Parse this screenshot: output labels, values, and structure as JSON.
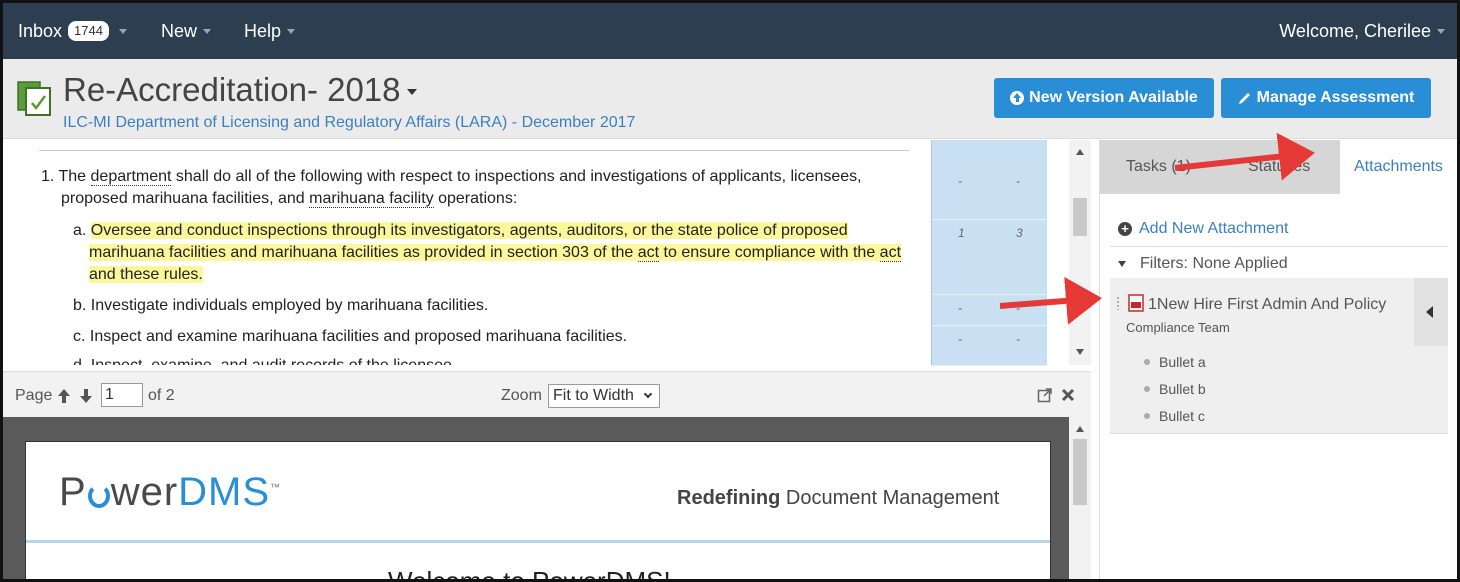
{
  "nav": {
    "inbox_label": "Inbox",
    "inbox_count": "1744",
    "new_label": "New",
    "help_label": "Help",
    "welcome": "Welcome, Cherilee"
  },
  "header": {
    "title": "Re-Accreditation- 2018",
    "subtitle": "ILC-MI Department of Licensing and Regulatory Affairs (LARA) - December 2017",
    "new_version_label": "New Version Available",
    "manage_label": "Manage Assessment"
  },
  "content": {
    "item1_num": "1.",
    "item1_line1_pre": "The ",
    "item1_line1_link": "department",
    "item1_line1_post": " shall do all of the following with respect to inspections and investigations of applicants, licensees,",
    "item1_line2_pre": "proposed marihuana facilities, and ",
    "item1_line2_link": "marihuana facility",
    "item1_line2_post": " operations:",
    "a_label": "a.",
    "a_line1": "Oversee and conduct inspections through its investigators, agents, auditors, or the state police of proposed",
    "a_line2_pre": "marihuana facilities and marihuana facilities as provided in section 303 of the ",
    "a_line2_link1": "act",
    "a_line2_mid": " to ensure compliance with the ",
    "a_line2_link2": "act",
    "a_line3": "and these rules.",
    "b_label": "b.",
    "b_text": "Investigate individuals employed by marihuana facilities.",
    "c_label": "c.",
    "c_text": "Inspect and examine marihuana facilities and proposed marihuana facilities.",
    "d_label": "d.",
    "d_text": "Inspect, examine, and audit records of the licensee."
  },
  "columns": {
    "row1": [
      "-",
      "-"
    ],
    "row2": [
      "1",
      "3"
    ],
    "row3": [
      "-",
      "-"
    ],
    "row4": [
      "-",
      "-"
    ]
  },
  "viewer": {
    "page_label": "Page",
    "page_value": "1",
    "of_label": "of 2",
    "zoom_label": "Zoom",
    "zoom_value": "Fit to Width"
  },
  "pdf": {
    "logo_prefix": "P",
    "logo_mid": "wer",
    "logo_suffix": "DMS",
    "logo_tm": "™",
    "tagline_bold": "Redefining",
    "tagline_rest": " Document Management",
    "welcome": "Welcome to PowerDMS!"
  },
  "right_panel": {
    "tab_tasks": "Tasks (1)",
    "tab_statuses": "Statuses",
    "tab_attachments": "Attachments",
    "add_attachment": "Add New Attachment",
    "filters": "Filters: None Applied",
    "attachment_name": "1New Hire First Admin And Policy",
    "attachment_team": "Compliance Team",
    "bullets": [
      "Bullet a",
      "Bullet b",
      "Bullet c"
    ]
  },
  "colors": {
    "nav_bg": "#2c3e50",
    "accent": "#2a8ed6",
    "link": "#3b7fc1",
    "highlight": "#fbf79a",
    "annotation_arrow": "#e53935"
  }
}
